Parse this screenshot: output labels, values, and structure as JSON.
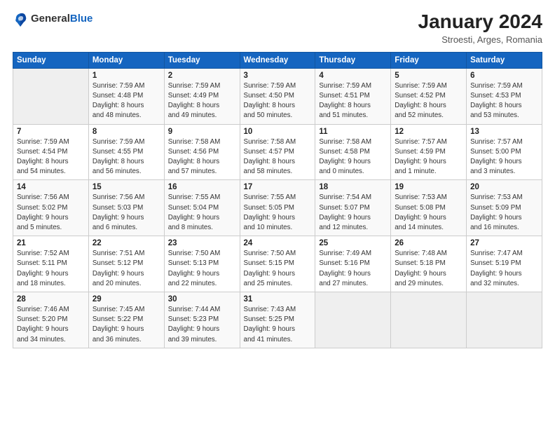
{
  "logo": {
    "text_general": "General",
    "text_blue": "Blue"
  },
  "header": {
    "title": "January 2024",
    "subtitle": "Stroesti, Arges, Romania"
  },
  "weekdays": [
    "Sunday",
    "Monday",
    "Tuesday",
    "Wednesday",
    "Thursday",
    "Friday",
    "Saturday"
  ],
  "weeks": [
    [
      {
        "day": "",
        "info": ""
      },
      {
        "day": "1",
        "info": "Sunrise: 7:59 AM\nSunset: 4:48 PM\nDaylight: 8 hours\nand 48 minutes."
      },
      {
        "day": "2",
        "info": "Sunrise: 7:59 AM\nSunset: 4:49 PM\nDaylight: 8 hours\nand 49 minutes."
      },
      {
        "day": "3",
        "info": "Sunrise: 7:59 AM\nSunset: 4:50 PM\nDaylight: 8 hours\nand 50 minutes."
      },
      {
        "day": "4",
        "info": "Sunrise: 7:59 AM\nSunset: 4:51 PM\nDaylight: 8 hours\nand 51 minutes."
      },
      {
        "day": "5",
        "info": "Sunrise: 7:59 AM\nSunset: 4:52 PM\nDaylight: 8 hours\nand 52 minutes."
      },
      {
        "day": "6",
        "info": "Sunrise: 7:59 AM\nSunset: 4:53 PM\nDaylight: 8 hours\nand 53 minutes."
      }
    ],
    [
      {
        "day": "7",
        "info": "Sunrise: 7:59 AM\nSunset: 4:54 PM\nDaylight: 8 hours\nand 54 minutes."
      },
      {
        "day": "8",
        "info": "Sunrise: 7:59 AM\nSunset: 4:55 PM\nDaylight: 8 hours\nand 56 minutes."
      },
      {
        "day": "9",
        "info": "Sunrise: 7:58 AM\nSunset: 4:56 PM\nDaylight: 8 hours\nand 57 minutes."
      },
      {
        "day": "10",
        "info": "Sunrise: 7:58 AM\nSunset: 4:57 PM\nDaylight: 8 hours\nand 58 minutes."
      },
      {
        "day": "11",
        "info": "Sunrise: 7:58 AM\nSunset: 4:58 PM\nDaylight: 9 hours\nand 0 minutes."
      },
      {
        "day": "12",
        "info": "Sunrise: 7:57 AM\nSunset: 4:59 PM\nDaylight: 9 hours\nand 1 minute."
      },
      {
        "day": "13",
        "info": "Sunrise: 7:57 AM\nSunset: 5:00 PM\nDaylight: 9 hours\nand 3 minutes."
      }
    ],
    [
      {
        "day": "14",
        "info": "Sunrise: 7:56 AM\nSunset: 5:02 PM\nDaylight: 9 hours\nand 5 minutes."
      },
      {
        "day": "15",
        "info": "Sunrise: 7:56 AM\nSunset: 5:03 PM\nDaylight: 9 hours\nand 6 minutes."
      },
      {
        "day": "16",
        "info": "Sunrise: 7:55 AM\nSunset: 5:04 PM\nDaylight: 9 hours\nand 8 minutes."
      },
      {
        "day": "17",
        "info": "Sunrise: 7:55 AM\nSunset: 5:05 PM\nDaylight: 9 hours\nand 10 minutes."
      },
      {
        "day": "18",
        "info": "Sunrise: 7:54 AM\nSunset: 5:07 PM\nDaylight: 9 hours\nand 12 minutes."
      },
      {
        "day": "19",
        "info": "Sunrise: 7:53 AM\nSunset: 5:08 PM\nDaylight: 9 hours\nand 14 minutes."
      },
      {
        "day": "20",
        "info": "Sunrise: 7:53 AM\nSunset: 5:09 PM\nDaylight: 9 hours\nand 16 minutes."
      }
    ],
    [
      {
        "day": "21",
        "info": "Sunrise: 7:52 AM\nSunset: 5:11 PM\nDaylight: 9 hours\nand 18 minutes."
      },
      {
        "day": "22",
        "info": "Sunrise: 7:51 AM\nSunset: 5:12 PM\nDaylight: 9 hours\nand 20 minutes."
      },
      {
        "day": "23",
        "info": "Sunrise: 7:50 AM\nSunset: 5:13 PM\nDaylight: 9 hours\nand 22 minutes."
      },
      {
        "day": "24",
        "info": "Sunrise: 7:50 AM\nSunset: 5:15 PM\nDaylight: 9 hours\nand 25 minutes."
      },
      {
        "day": "25",
        "info": "Sunrise: 7:49 AM\nSunset: 5:16 PM\nDaylight: 9 hours\nand 27 minutes."
      },
      {
        "day": "26",
        "info": "Sunrise: 7:48 AM\nSunset: 5:18 PM\nDaylight: 9 hours\nand 29 minutes."
      },
      {
        "day": "27",
        "info": "Sunrise: 7:47 AM\nSunset: 5:19 PM\nDaylight: 9 hours\nand 32 minutes."
      }
    ],
    [
      {
        "day": "28",
        "info": "Sunrise: 7:46 AM\nSunset: 5:20 PM\nDaylight: 9 hours\nand 34 minutes."
      },
      {
        "day": "29",
        "info": "Sunrise: 7:45 AM\nSunset: 5:22 PM\nDaylight: 9 hours\nand 36 minutes."
      },
      {
        "day": "30",
        "info": "Sunrise: 7:44 AM\nSunset: 5:23 PM\nDaylight: 9 hours\nand 39 minutes."
      },
      {
        "day": "31",
        "info": "Sunrise: 7:43 AM\nSunset: 5:25 PM\nDaylight: 9 hours\nand 41 minutes."
      },
      {
        "day": "",
        "info": ""
      },
      {
        "day": "",
        "info": ""
      },
      {
        "day": "",
        "info": ""
      }
    ]
  ]
}
